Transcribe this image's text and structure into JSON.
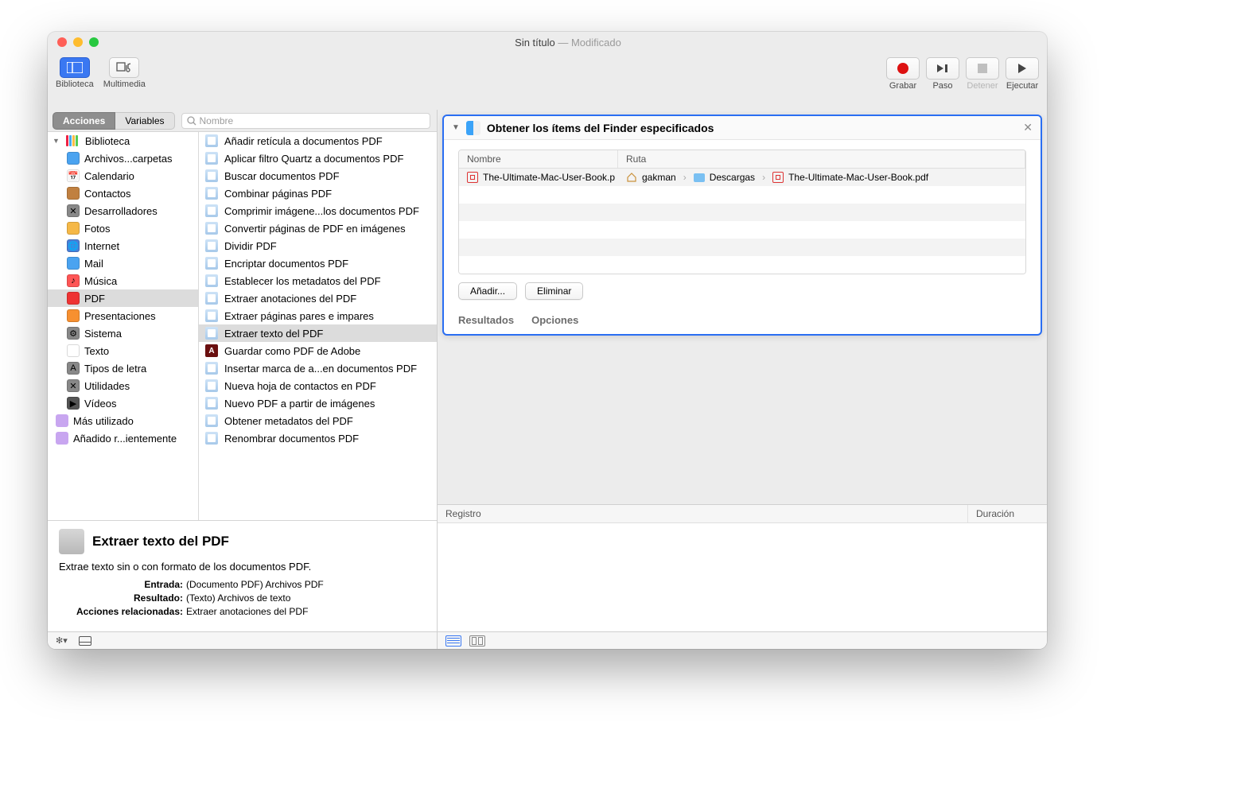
{
  "window": {
    "title": "Sin título",
    "modified": " — Modificado"
  },
  "toolbar": {
    "library": "Biblioteca",
    "media": "Multimedia",
    "record": "Grabar",
    "step": "Paso",
    "stop": "Detener",
    "run": "Ejecutar"
  },
  "tabs": {
    "actions": "Acciones",
    "variables": "Variables"
  },
  "search": {
    "placeholder": "Nombre"
  },
  "sidebar": {
    "header": "Biblioteca",
    "items": [
      "Archivos...carpetas",
      "Calendario",
      "Contactos",
      "Desarrolladores",
      "Fotos",
      "Internet",
      "Mail",
      "Música",
      "PDF",
      "Presentaciones",
      "Sistema",
      "Texto",
      "Tipos de letra",
      "Utilidades",
      "Vídeos"
    ],
    "smart": [
      "Más utilizado",
      "Añadido r...ientemente"
    ],
    "selected_index": 8
  },
  "actions": {
    "items": [
      "Añadir retícula a documentos PDF",
      "Aplicar filtro Quartz a documentos PDF",
      "Buscar documentos PDF",
      "Combinar páginas PDF",
      "Comprimir imágene...los documentos PDF",
      "Convertir páginas de PDF en imágenes",
      "Dividir PDF",
      "Encriptar documentos PDF",
      "Establecer los metadatos del PDF",
      "Extraer anotaciones del PDF",
      "Extraer páginas pares e impares",
      "Extraer texto del PDF",
      "Guardar como PDF de Adobe",
      "Insertar marca de a...en documentos PDF",
      "Nueva hoja de contactos en PDF",
      "Nuevo PDF a partir de imágenes",
      "Obtener metadatos del PDF",
      "Renombrar documentos PDF"
    ],
    "selected_index": 11,
    "adobe_index": 12
  },
  "description": {
    "title": "Extraer texto del PDF",
    "subtitle": "Extrae texto sin o con formato de los documentos PDF.",
    "rows": [
      {
        "label": "Entrada:",
        "value": "(Documento PDF) Archivos PDF"
      },
      {
        "label": "Resultado:",
        "value": "(Texto) Archivos de texto"
      },
      {
        "label": "Acciones relacionadas:",
        "value": "Extraer anotaciones del PDF"
      }
    ]
  },
  "card": {
    "title": "Obtener los ítems del Finder especificados",
    "columns": {
      "name": "Nombre",
      "path": "Ruta"
    },
    "row": {
      "filename": "The-Ultimate-Mac-User-Book.p",
      "crumb_user": "gakman",
      "crumb_folder": "Descargas",
      "crumb_file": "The-Ultimate-Mac-User-Book.pdf"
    },
    "add": "Añadir...",
    "remove": "Eliminar",
    "results": "Resultados",
    "options": "Opciones"
  },
  "log": {
    "col1": "Registro",
    "col2": "Duración"
  }
}
